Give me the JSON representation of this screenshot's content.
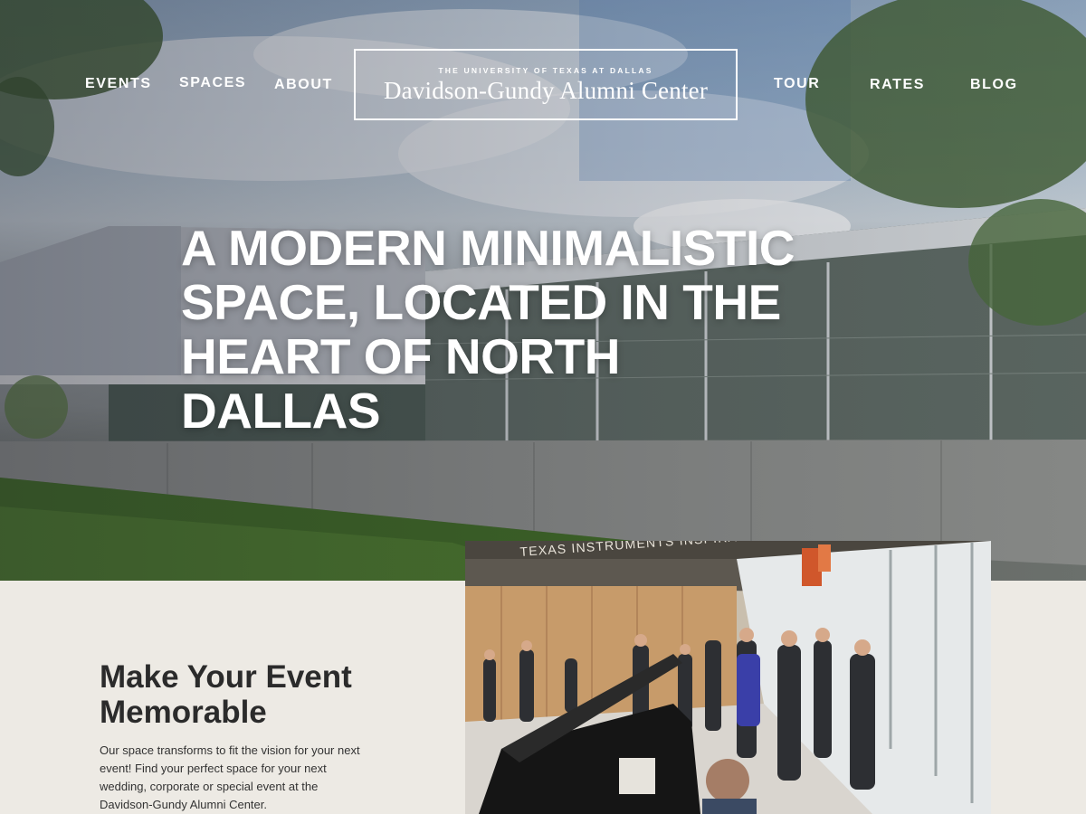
{
  "nav": {
    "left": [
      "EVENTS",
      "SPACES",
      "ABOUT"
    ],
    "right": [
      "TOUR",
      "RATES",
      "BLOG"
    ]
  },
  "logo": {
    "subtitle": "THE UNIVERSITY OF TEXAS AT DALLAS",
    "title": "Davidson-Gundy Alumni Center"
  },
  "hero": {
    "headline": "A MODERN MINIMALISTIC SPACE, LOCATED IN THE HEART OF NORTH DALLAS"
  },
  "intro": {
    "title": "Make Your Event Memorable",
    "text": "Our space transforms to fit the vision for your next event! Find your perfect space for your next wedding, corporate or special event at the Davidson-Gundy Alumni Center."
  },
  "photo": {
    "sign_text": "TEXAS INSTRUMENTS INSPIRATION HALL"
  }
}
